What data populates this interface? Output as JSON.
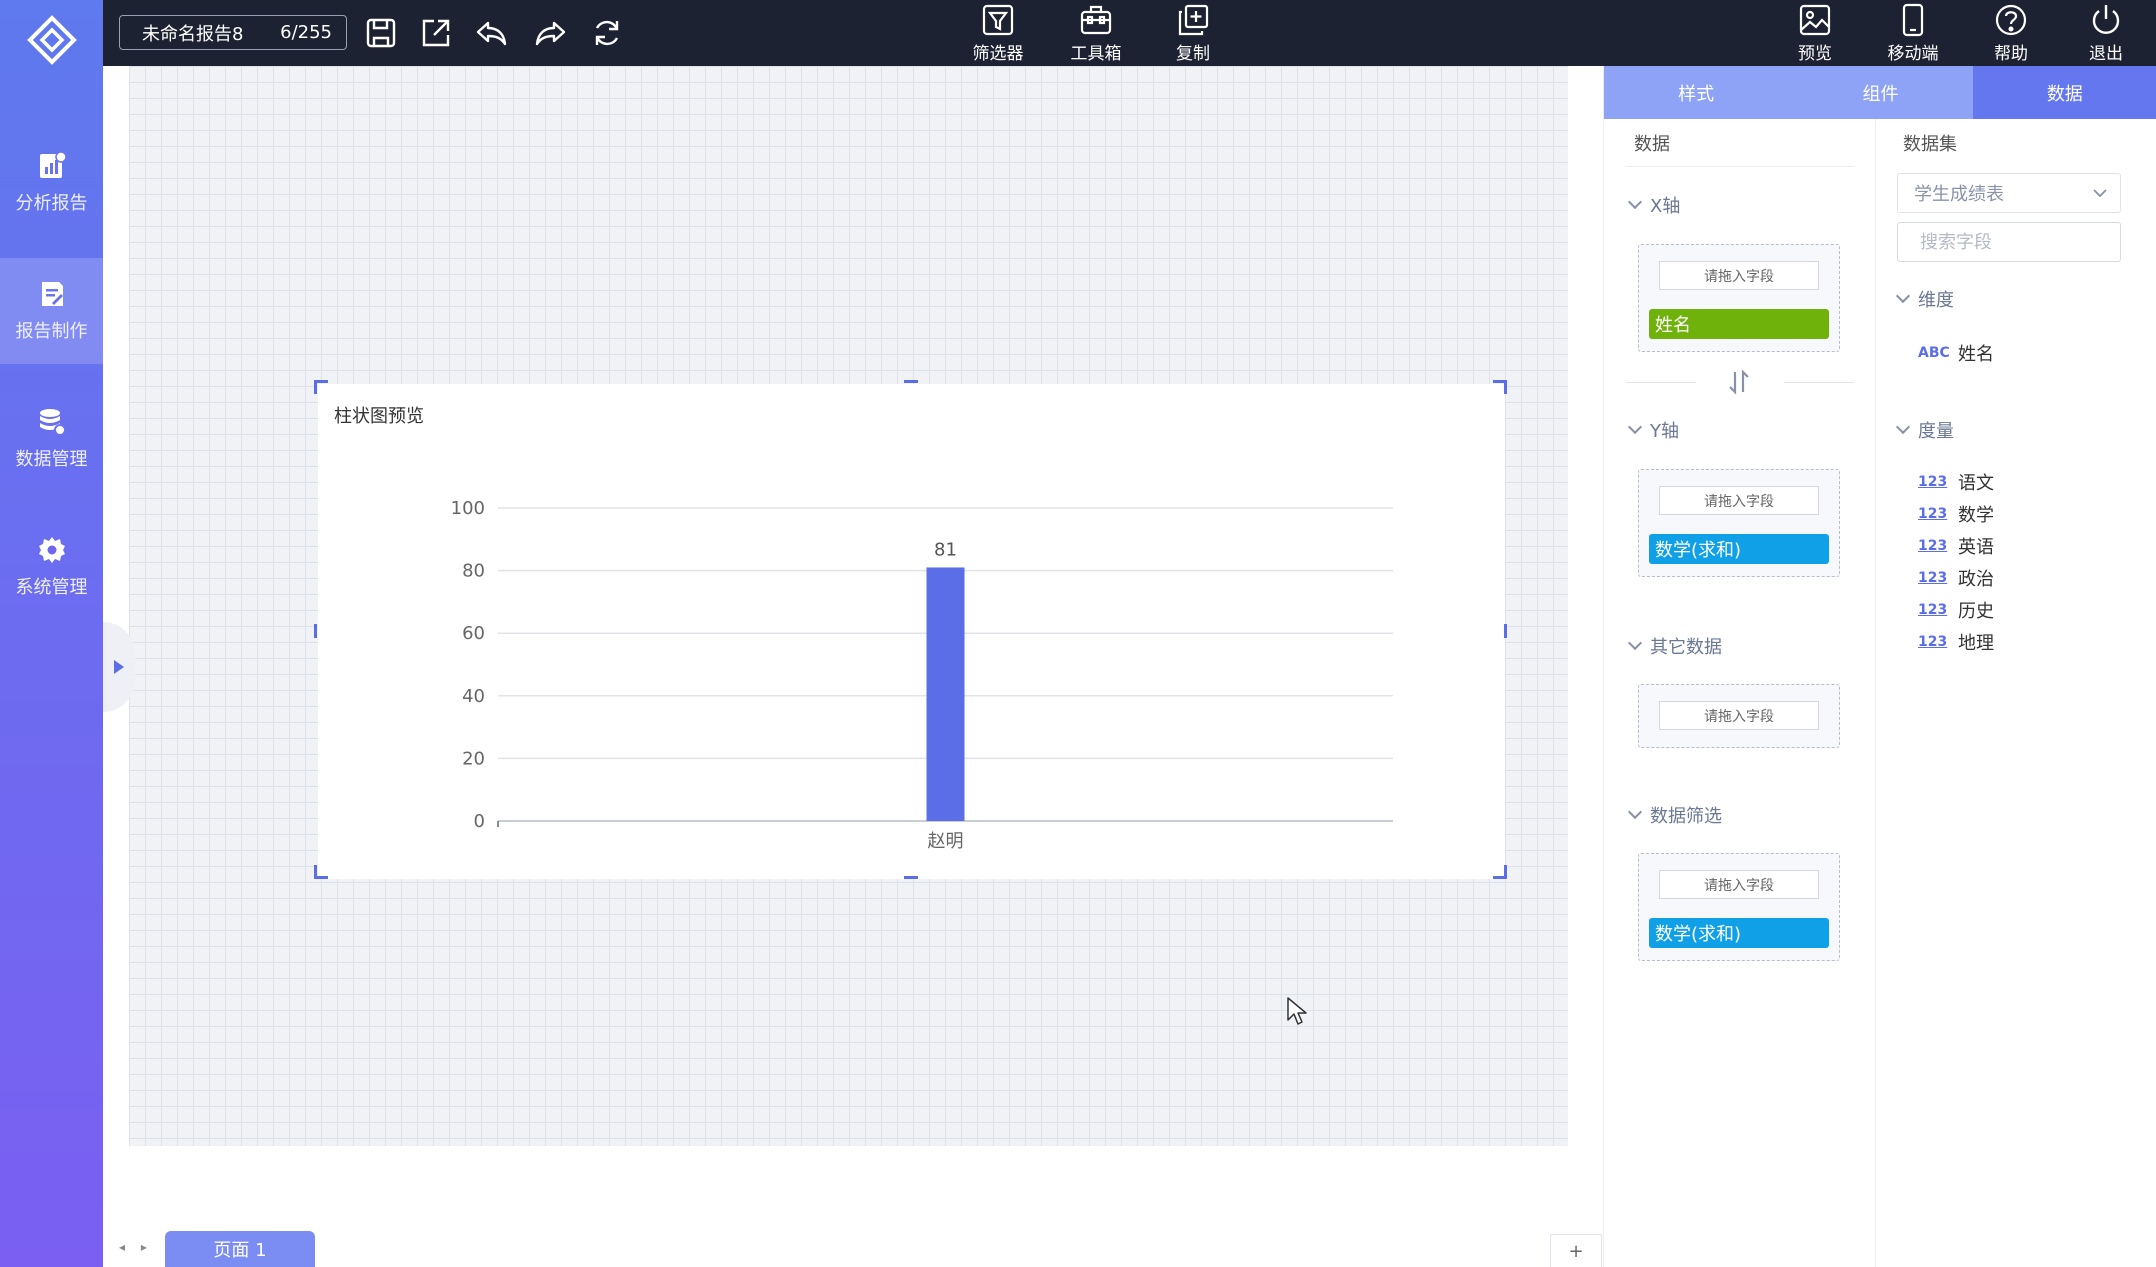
{
  "sidebar": {
    "items": [
      {
        "label": "分析报告",
        "icon": "analysis-report-icon"
      },
      {
        "label": "报告制作",
        "icon": "report-edit-icon",
        "active": true
      },
      {
        "label": "数据管理",
        "icon": "database-settings-icon"
      },
      {
        "label": "系统管理",
        "icon": "gear-icon"
      }
    ]
  },
  "topbar": {
    "report_name": "未命名报告8",
    "char_count": "6/255",
    "center_buttons": [
      {
        "label": "筛选器",
        "icon": "filter-icon"
      },
      {
        "label": "工具箱",
        "icon": "toolbox-icon"
      },
      {
        "label": "复制",
        "icon": "copy-icon"
      }
    ],
    "right_buttons": [
      {
        "label": "预览",
        "icon": "preview-image-icon"
      },
      {
        "label": "移动端",
        "icon": "mobile-icon"
      },
      {
        "label": "帮助",
        "icon": "help-icon"
      },
      {
        "label": "退出",
        "icon": "power-icon"
      }
    ]
  },
  "chart_widget": {
    "title": "柱状图预览"
  },
  "chart_data": {
    "type": "bar",
    "title": "柱状图预览",
    "categories": [
      "赵明"
    ],
    "series": [
      {
        "values": [
          81
        ]
      }
    ],
    "data_labels": [
      "81"
    ],
    "ylim": [
      0,
      100
    ],
    "yticks": [
      0,
      20,
      40,
      60,
      80,
      100
    ],
    "grid": true,
    "bar_color": "#5b6ee8"
  },
  "pages": {
    "nav": "◂ ▸",
    "active_tab": "页面 1",
    "add_label": "+"
  },
  "panel": {
    "tabs": [
      {
        "label": "样式"
      },
      {
        "label": "组件"
      },
      {
        "label": "数据",
        "active": true
      }
    ],
    "data_column": {
      "header": "数据",
      "x_axis": {
        "label": "X轴",
        "placeholder": "请拖入字段",
        "fields": [
          "姓名"
        ]
      },
      "y_axis": {
        "label": "Y轴",
        "placeholder": "请拖入字段",
        "fields": [
          "数学(求和)"
        ]
      },
      "other": {
        "label": "其它数据",
        "placeholder": "请拖入字段"
      },
      "filter": {
        "label": "数据筛选",
        "placeholder": "请拖入字段",
        "fields": [
          "数学(求和)"
        ]
      }
    },
    "dataset_column": {
      "header": "数据集",
      "selected_dataset": "学生成绩表",
      "search_placeholder": "搜索字段",
      "dimension_label": "维度",
      "dimension_type": "ABC",
      "dimensions": [
        "姓名"
      ],
      "measure_label": "度量",
      "measure_type": "123",
      "measures": [
        "语文",
        "数学",
        "英语",
        "政治",
        "历史",
        "地理"
      ]
    }
  },
  "colors": {
    "accent": "#5b6ee8",
    "sidebar_top": "#5f79ee",
    "sidebar_bottom": "#7a5ff2",
    "topbar": "#1d2233",
    "chip_green": "#6fb20b",
    "chip_blue": "#10a0e8"
  }
}
